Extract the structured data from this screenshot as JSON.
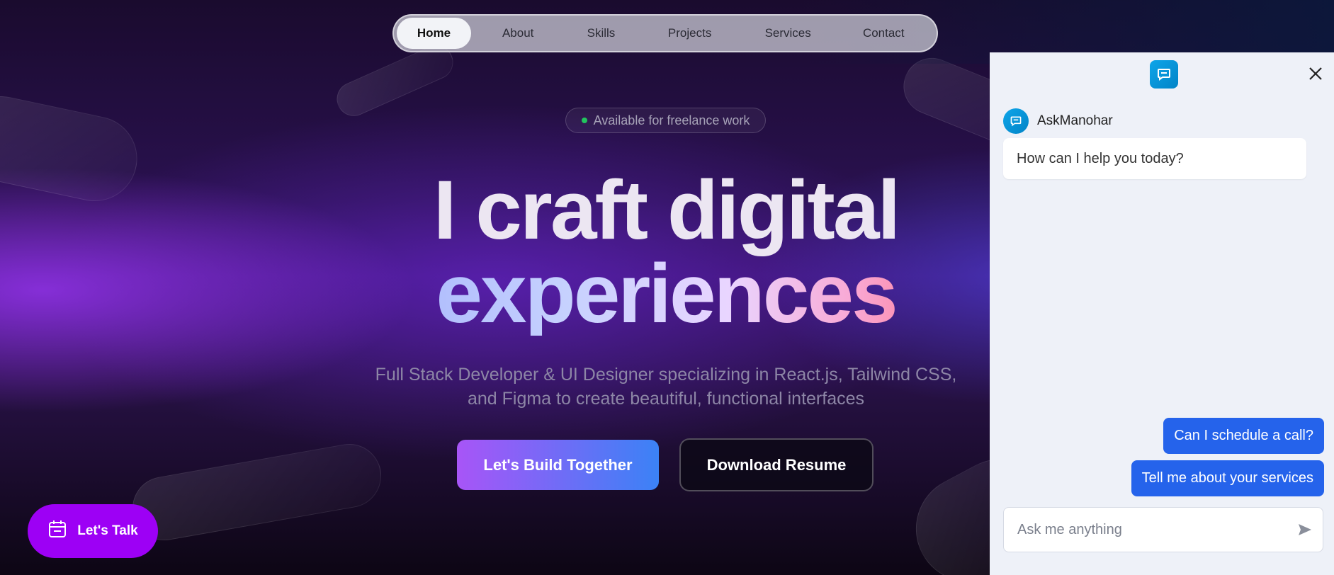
{
  "nav": {
    "items": [
      {
        "label": "Home",
        "active": true
      },
      {
        "label": "About"
      },
      {
        "label": "Skills"
      },
      {
        "label": "Projects"
      },
      {
        "label": "Services"
      },
      {
        "label": "Contact"
      }
    ]
  },
  "hero": {
    "badge": "Available for freelance work",
    "headline_line1": "I craft digital",
    "headline_line2": "experiences",
    "subtitle_line1": "Full Stack Developer & UI Designer specializing in React.js, Tailwind CSS,",
    "subtitle_line2": "and Figma to create beautiful, functional interfaces",
    "primary_button": "Let's Build Together",
    "secondary_button": "Download Resume"
  },
  "floating": {
    "talk_label": "Let's Talk"
  },
  "chat": {
    "bot_name": "AskManohar",
    "bot_greeting": "How can I help you today?",
    "suggestions": [
      "Can I schedule a call?",
      "Tell me about your services"
    ],
    "input_placeholder": "Ask me anything"
  },
  "colors": {
    "accent_purple": "#9d00f5",
    "accent_blue": "#2563eb",
    "chat_bg": "#eef1f8",
    "status_green": "#22c55e"
  },
  "icons": {
    "chat_logo": "chat-bubble-icon",
    "close": "close-icon",
    "send": "send-icon",
    "calendar": "calendar-icon"
  }
}
